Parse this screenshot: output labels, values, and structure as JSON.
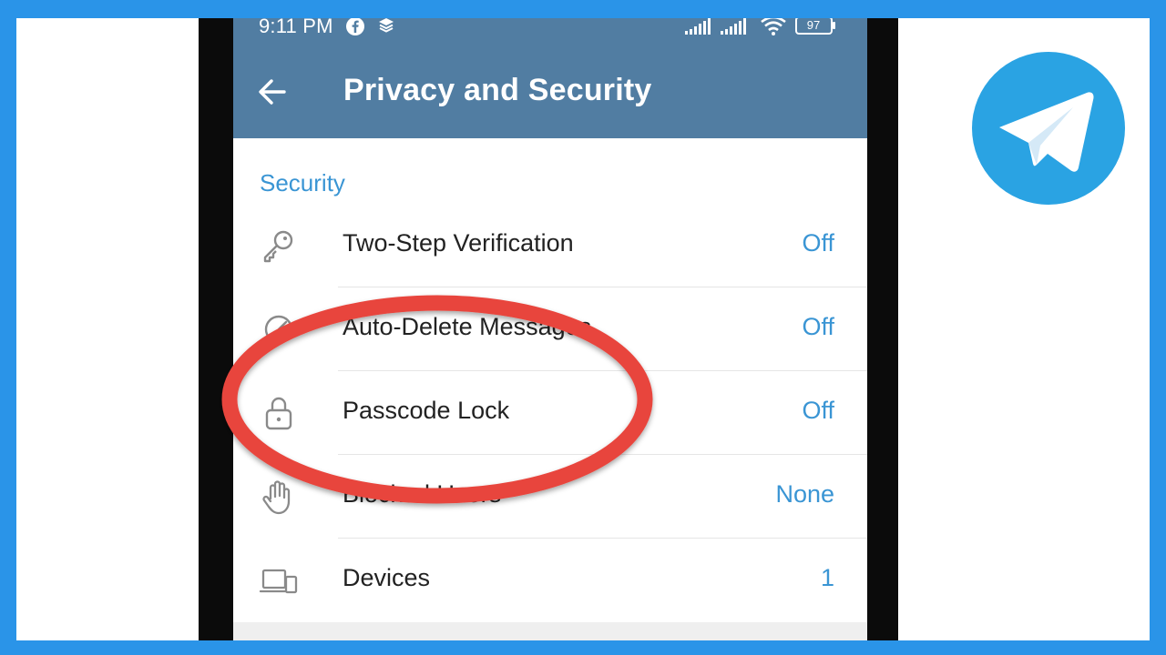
{
  "status_bar": {
    "time": "9:11 PM",
    "battery": "97"
  },
  "app_bar": {
    "title": "Privacy and Security"
  },
  "section": {
    "header": "Security"
  },
  "rows": [
    {
      "label": "Two-Step Verification",
      "value": "Off",
      "icon": "key-icon"
    },
    {
      "label": "Auto-Delete Messages",
      "value": "Off",
      "icon": "timer-icon"
    },
    {
      "label": "Passcode Lock",
      "value": "Off",
      "icon": "lock-icon"
    },
    {
      "label": "Blocked Users",
      "value": "None",
      "icon": "hand-icon"
    },
    {
      "label": "Devices",
      "value": "1",
      "icon": "devices-icon"
    }
  ],
  "colors": {
    "frame": "#2a94e8",
    "app_bar": "#517da2",
    "accent_text": "#3a95d4",
    "annotation": "#e8453c",
    "telegram": "#2aa3e3"
  }
}
